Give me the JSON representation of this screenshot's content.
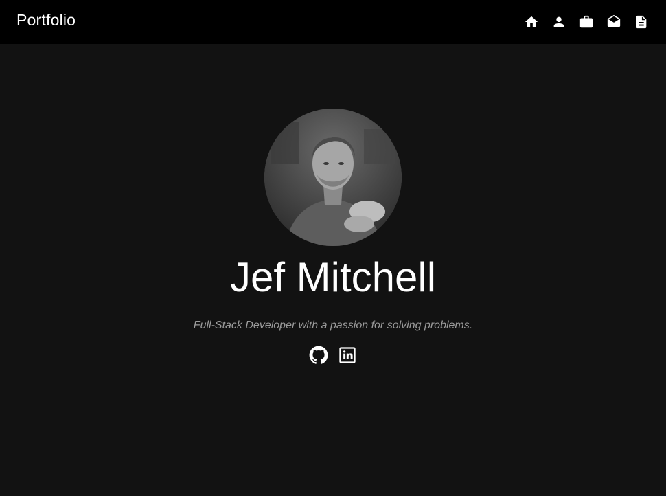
{
  "header": {
    "brand": "Portfolio",
    "nav": [
      {
        "icon": "home-icon",
        "name": "nav-home"
      },
      {
        "icon": "person-icon",
        "name": "nav-about"
      },
      {
        "icon": "briefcase-icon",
        "name": "nav-work"
      },
      {
        "icon": "mail-icon",
        "name": "nav-contact"
      },
      {
        "icon": "document-icon",
        "name": "nav-resume"
      }
    ]
  },
  "profile": {
    "name": "Jef Mitchell",
    "tagline": "Full-Stack Developer with a passion for solving problems.",
    "socials": [
      {
        "icon": "github-icon"
      },
      {
        "icon": "linkedin-icon"
      }
    ]
  },
  "colors": {
    "header_bg": "#000000",
    "page_bg": "#121212",
    "text": "#ffffff",
    "muted": "#9b9b9b"
  }
}
